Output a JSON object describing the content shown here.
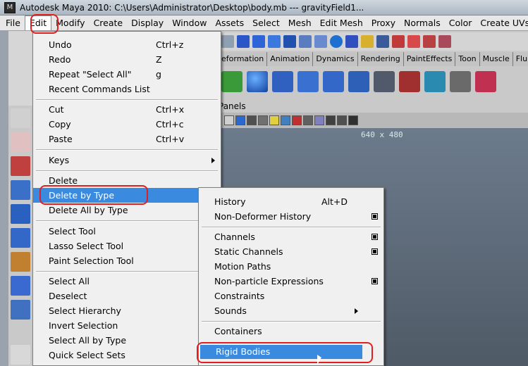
{
  "window": {
    "title": "Autodesk Maya 2010: C:\\Users\\Administrator\\Desktop\\body.mb  ---  gravityField1..."
  },
  "menubar": {
    "items": [
      "File",
      "Edit",
      "Modify",
      "Create",
      "Display",
      "Window",
      "Assets",
      "Select",
      "Mesh",
      "Edit Mesh",
      "Proxy",
      "Normals",
      "Color",
      "Create UVs"
    ],
    "open_item": "Edit"
  },
  "shelf": {
    "tabs": [
      "eformation",
      "Animation",
      "Dynamics",
      "Rendering",
      "PaintEffects",
      "Toon",
      "Muscle",
      "Fluids"
    ]
  },
  "panels_label": "Panels",
  "viewport": {
    "resolution": "640 x 480"
  },
  "edit_menu": {
    "items": [
      {
        "label": "Undo",
        "shortcut": "Ctrl+z"
      },
      {
        "label": "Redo",
        "shortcut": "Z"
      },
      {
        "label": "Repeat \"Select All\"",
        "shortcut": "g"
      },
      {
        "label": "Recent Commands List",
        "shortcut": ""
      },
      {
        "label": "Cut",
        "shortcut": "Ctrl+x"
      },
      {
        "label": "Copy",
        "shortcut": "Ctrl+c"
      },
      {
        "label": "Paste",
        "shortcut": "Ctrl+v"
      },
      {
        "label": "Keys",
        "shortcut": ""
      },
      {
        "label": "Delete",
        "shortcut": ""
      },
      {
        "label": "Delete by Type",
        "shortcut": ""
      },
      {
        "label": "Delete All by Type",
        "shortcut": ""
      },
      {
        "label": "Select Tool",
        "shortcut": ""
      },
      {
        "label": "Lasso Select Tool",
        "shortcut": ""
      },
      {
        "label": "Paint Selection Tool",
        "shortcut": ""
      },
      {
        "label": "Select All",
        "shortcut": ""
      },
      {
        "label": "Deselect",
        "shortcut": ""
      },
      {
        "label": "Select Hierarchy",
        "shortcut": ""
      },
      {
        "label": "Invert Selection",
        "shortcut": ""
      },
      {
        "label": "Select All by Type",
        "shortcut": ""
      },
      {
        "label": "Quick Select Sets",
        "shortcut": ""
      }
    ],
    "highlighted": "Delete by Type"
  },
  "delete_by_type_submenu": {
    "items": [
      {
        "label": "History",
        "shortcut": "Alt+D"
      },
      {
        "label": "Non-Deformer History",
        "shortcut": ""
      },
      {
        "label": "Channels",
        "shortcut": ""
      },
      {
        "label": "Static Channels",
        "shortcut": ""
      },
      {
        "label": "Motion Paths",
        "shortcut": ""
      },
      {
        "label": "Non-particle Expressions",
        "shortcut": ""
      },
      {
        "label": "Constraints",
        "shortcut": ""
      },
      {
        "label": "Sounds",
        "shortcut": ""
      },
      {
        "label": "Containers",
        "shortcut": ""
      },
      {
        "label": "Rigid Bodies",
        "shortcut": ""
      }
    ],
    "highlighted": "Rigid Bodies"
  },
  "colors": {
    "highlight": "#3a8ae0",
    "annotation_ring": "#e02020"
  }
}
